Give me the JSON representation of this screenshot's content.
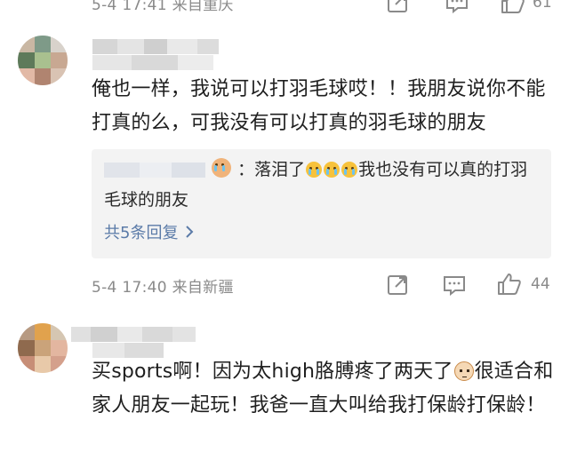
{
  "comment_top": {
    "meta": "5-4 17:41 来自重庆",
    "like_count": "61"
  },
  "comment_1": {
    "body": "俺也一样，我说可以打羽毛球哎！！我朋友说你不能打真的么，可我没有可以打真的羽毛球的朋友",
    "reply": {
      "text_before": "：落泪了",
      "text_after": "我也没有可以真的打羽毛球的朋友",
      "more_label": "共5条回复"
    },
    "meta": "5-4 17:40 来自新疆",
    "like_count": "44"
  },
  "comment_2": {
    "text_before": "买sports啊！因为太high胳膊疼了两天了",
    "text_after": "很适合和家人朋友一起玩！我爸一直大叫给我打保龄打保龄！"
  },
  "icons": {
    "repost": "repost-icon",
    "comment": "comment-icon",
    "like": "thumbs-up-icon",
    "chevron": "chevron-right-icon",
    "crying_emoji": "crying-emoji-icon",
    "cat_emoji": "cat-emoji-icon"
  },
  "colors": {
    "meta_gray": "#8a8a8a",
    "reply_bg": "#f3f3f3",
    "link_blue": "#5b7ba8"
  }
}
